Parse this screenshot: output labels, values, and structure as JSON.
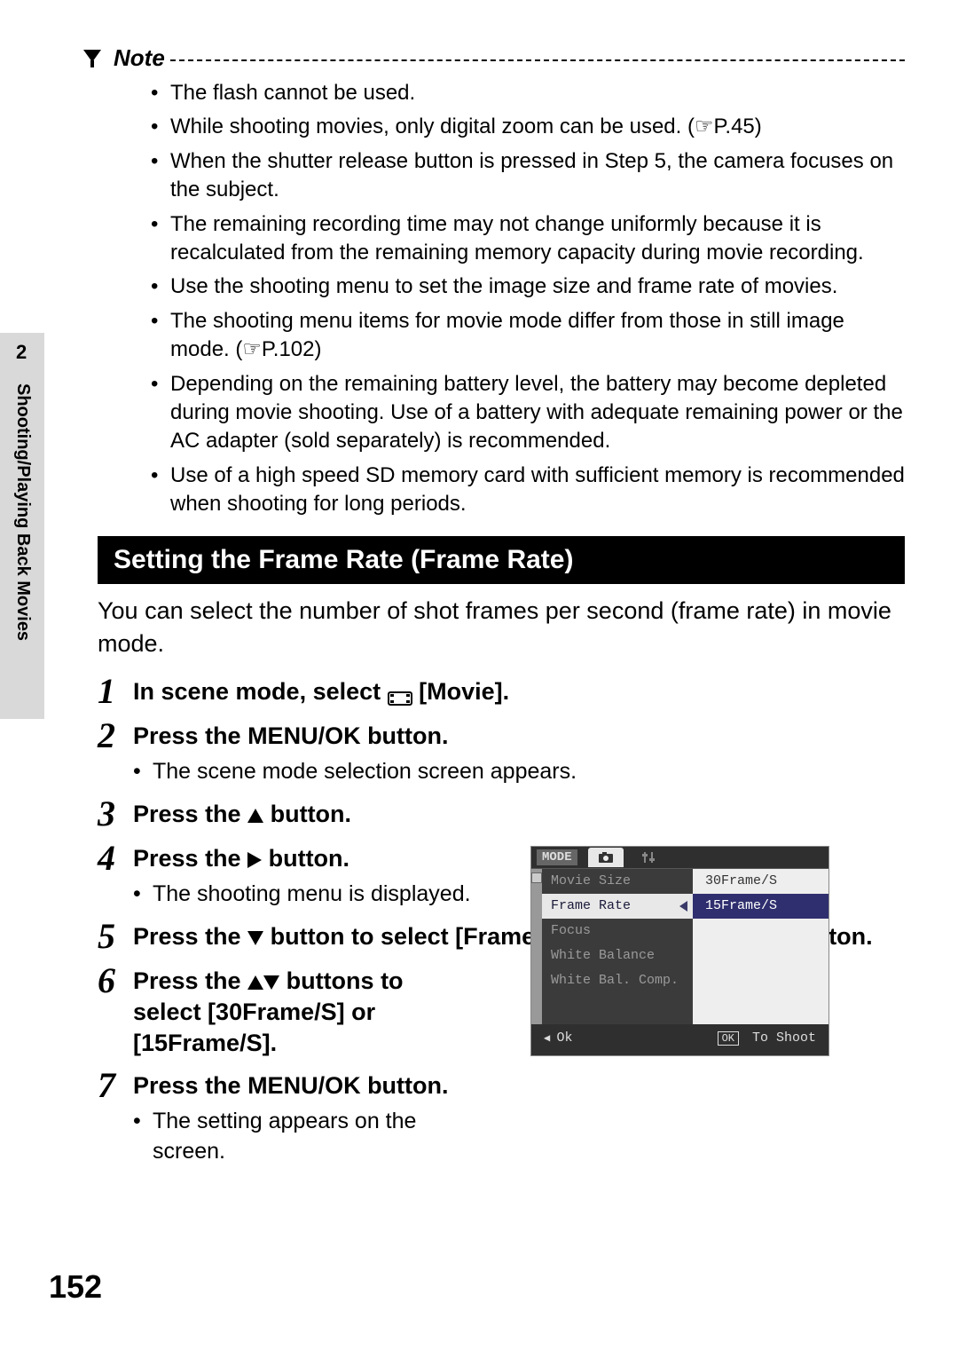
{
  "sidebar": {
    "chapter_number": "2",
    "chapter_title": "Shooting/Playing Back Movies"
  },
  "page_number": "152",
  "note": {
    "label": "Note",
    "items": [
      "The flash cannot be used.",
      "While shooting movies, only digital zoom can be used. (☞P.45)",
      "When the shutter release button is pressed in Step 5, the camera focuses on the subject.",
      "The remaining recording time may not change uniformly because it is recalculated from the remaining memory capacity during movie recording.",
      "Use the shooting menu to set the image size and frame rate of movies.",
      "The shooting menu items for movie mode differ from those in still image mode. (☞P.102)",
      "Depending on the remaining battery level, the battery may become depleted during movie shooting. Use of a battery with adequate remaining power or the AC adapter (sold separately) is recommended.",
      "Use of a high speed SD memory card with sufficient memory is recommended when shooting for long periods."
    ]
  },
  "section": {
    "heading": "Setting the Frame Rate (Frame Rate)",
    "intro": "You can select the number of shot frames per second (frame rate) in movie mode."
  },
  "steps": {
    "s1": {
      "num": "1",
      "prefix": "In scene mode, select ",
      "suffix": " [Movie]."
    },
    "s2": {
      "num": "2",
      "title": "Press the MENU/OK button.",
      "sub": "The scene mode selection screen appears."
    },
    "s3": {
      "num": "3",
      "prefix": "Press the ",
      "suffix": " button."
    },
    "s4": {
      "num": "4",
      "prefix": "Press the ",
      "suffix": " button.",
      "sub": "The shooting menu is displayed."
    },
    "s5": {
      "num": "5",
      "prefix": "Press the ",
      "mid": " button to select [Frame Rate] and press the ",
      "suffix": " button."
    },
    "s6": {
      "num": "6",
      "prefix": "Press the ",
      "suffix": " buttons to select [30Frame/S] or [15Frame/S]."
    },
    "s7": {
      "num": "7",
      "title": "Press the MENU/OK button.",
      "sub": "The setting appears on the screen."
    }
  },
  "lcd": {
    "mode_label": "MODE",
    "menu_items": [
      "Movie Size",
      "Frame Rate",
      "Focus",
      "White Balance",
      "White Bal. Comp."
    ],
    "selected_index": 1,
    "options": [
      "30Frame/S",
      "15Frame/S"
    ],
    "highlight_index": 1,
    "bottom_left": "Ok",
    "bottom_ok": "OK",
    "bottom_right": "To Shoot"
  }
}
